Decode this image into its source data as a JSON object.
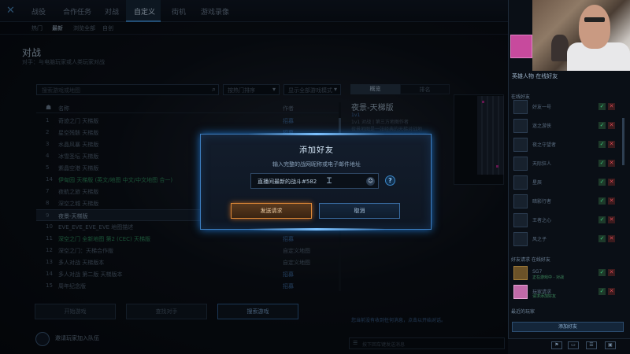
{
  "nav": {
    "tabs": [
      "战役",
      "合作任务",
      "对战",
      "自定义",
      "街机",
      "游戏录像"
    ],
    "active_index": 3
  },
  "subnav": {
    "tabs": [
      "热门",
      "最新",
      "浏览全部",
      "自创"
    ],
    "active_index": 1
  },
  "page": {
    "title": "对战",
    "subtitle": "对手：与电脑玩家或人类玩家对战"
  },
  "filters": {
    "search_placeholder": "搜索游戏或地图",
    "dropdown1": "按热门排序",
    "dropdown2": "显示全部游戏模式"
  },
  "list": {
    "header_name": "名称",
    "header_type": "作者",
    "rows": [
      {
        "num": "1",
        "name": "奇迹之门 天梯版",
        "tag": "招募",
        "hl": false
      },
      {
        "num": "2",
        "name": "星空残骸 天梯版",
        "tag": "招募",
        "hl": false
      },
      {
        "num": "3",
        "name": "水晶风暴 天梯版",
        "tag": "招募",
        "hl": false
      },
      {
        "num": "4",
        "name": "冰雪圣坛 天梯版",
        "tag": "招募",
        "hl": false
      },
      {
        "num": "5",
        "name": "紫晶空港 天梯版",
        "tag": "招募",
        "hl": false
      },
      {
        "num": "14",
        "name": "伊甸园 天梯版 (英文/地图 中文/中文地图 合一)",
        "tag": "招募",
        "hl": true
      },
      {
        "num": "7",
        "name": "夜航之旅 天梯版",
        "tag": "招募",
        "hl": false
      },
      {
        "num": "8",
        "name": "深空之城 天梯版",
        "tag": "招募",
        "hl": false
      },
      {
        "num": "9",
        "name": "夜景-天梯版",
        "tag": "",
        "hl": false,
        "selected": true
      },
      {
        "num": "10",
        "name": "EVE_EVE_EVE_EVE 地图描述",
        "tag": "",
        "hl": false
      },
      {
        "num": "11",
        "name": "深空之门 全新地图 第2 (CEC) 天梯版",
        "tag": "招募",
        "hl": true
      },
      {
        "num": "12",
        "name": "深空之门：天梯合作版",
        "tag": "自定义地图",
        "hl": false
      },
      {
        "num": "13",
        "name": "多人对战 天梯版本",
        "tag": "自定义地图",
        "hl": false
      },
      {
        "num": "14",
        "name": "多人对战 第二版 天梯版本",
        "tag": "招募",
        "hl": false
      },
      {
        "num": "15",
        "name": "周年纪念版",
        "tag": "招募",
        "hl": false
      }
    ]
  },
  "bottom_buttons": [
    "开始游戏",
    "查找对手",
    "搜索游戏"
  ],
  "party": {
    "text": "邀请玩家加入队伍"
  },
  "detail": {
    "tabs": [
      "概览",
      "排名"
    ],
    "map_title": "夜景-天梯版",
    "players": "1v1",
    "meta": "1v1 对战 | 第三方地图作者",
    "description": "夜景地图是一张经典的天梯对战地图，地形多变，资源丰富，适合各种战术。",
    "chat_hint": "您当前没有收到任何消息，点击以开始对话。",
    "chat_placeholder": "按下回车键发送消息"
  },
  "modal": {
    "title": "添加好友",
    "prompt": "输入完整的战网昵称或电子邮件地址",
    "input_value": "直播间最新的战斗#582",
    "help": "?",
    "send_label": "发送请求",
    "cancel_label": "取消"
  },
  "friends": {
    "header": "英雄人物 在线好友",
    "section_online": "在线好友",
    "section_requests": "好友请求 在线好友",
    "section_recent": "最近的玩家",
    "add_friend_button": "添加好友",
    "list": [
      {
        "name": "好友一号",
        "status": ""
      },
      {
        "name": "迷之游侠",
        "status": ""
      },
      {
        "name": "夜之守望者",
        "status": ""
      },
      {
        "name": "天际狂人",
        "status": ""
      },
      {
        "name": "星辰",
        "status": ""
      },
      {
        "name": "暗影行者",
        "status": ""
      },
      {
        "name": "王者之心",
        "status": ""
      },
      {
        "name": "风之子",
        "status": ""
      }
    ],
    "requests": [
      {
        "name": "SG7",
        "status": "正在游戏中 - 对战"
      },
      {
        "name": "玩家请求",
        "status": "请求添加好友"
      }
    ]
  },
  "colors": {
    "accent": "#3b86c6",
    "send_button": "#e08a38",
    "online": "#3ec77a",
    "decline": "#d64a52"
  }
}
